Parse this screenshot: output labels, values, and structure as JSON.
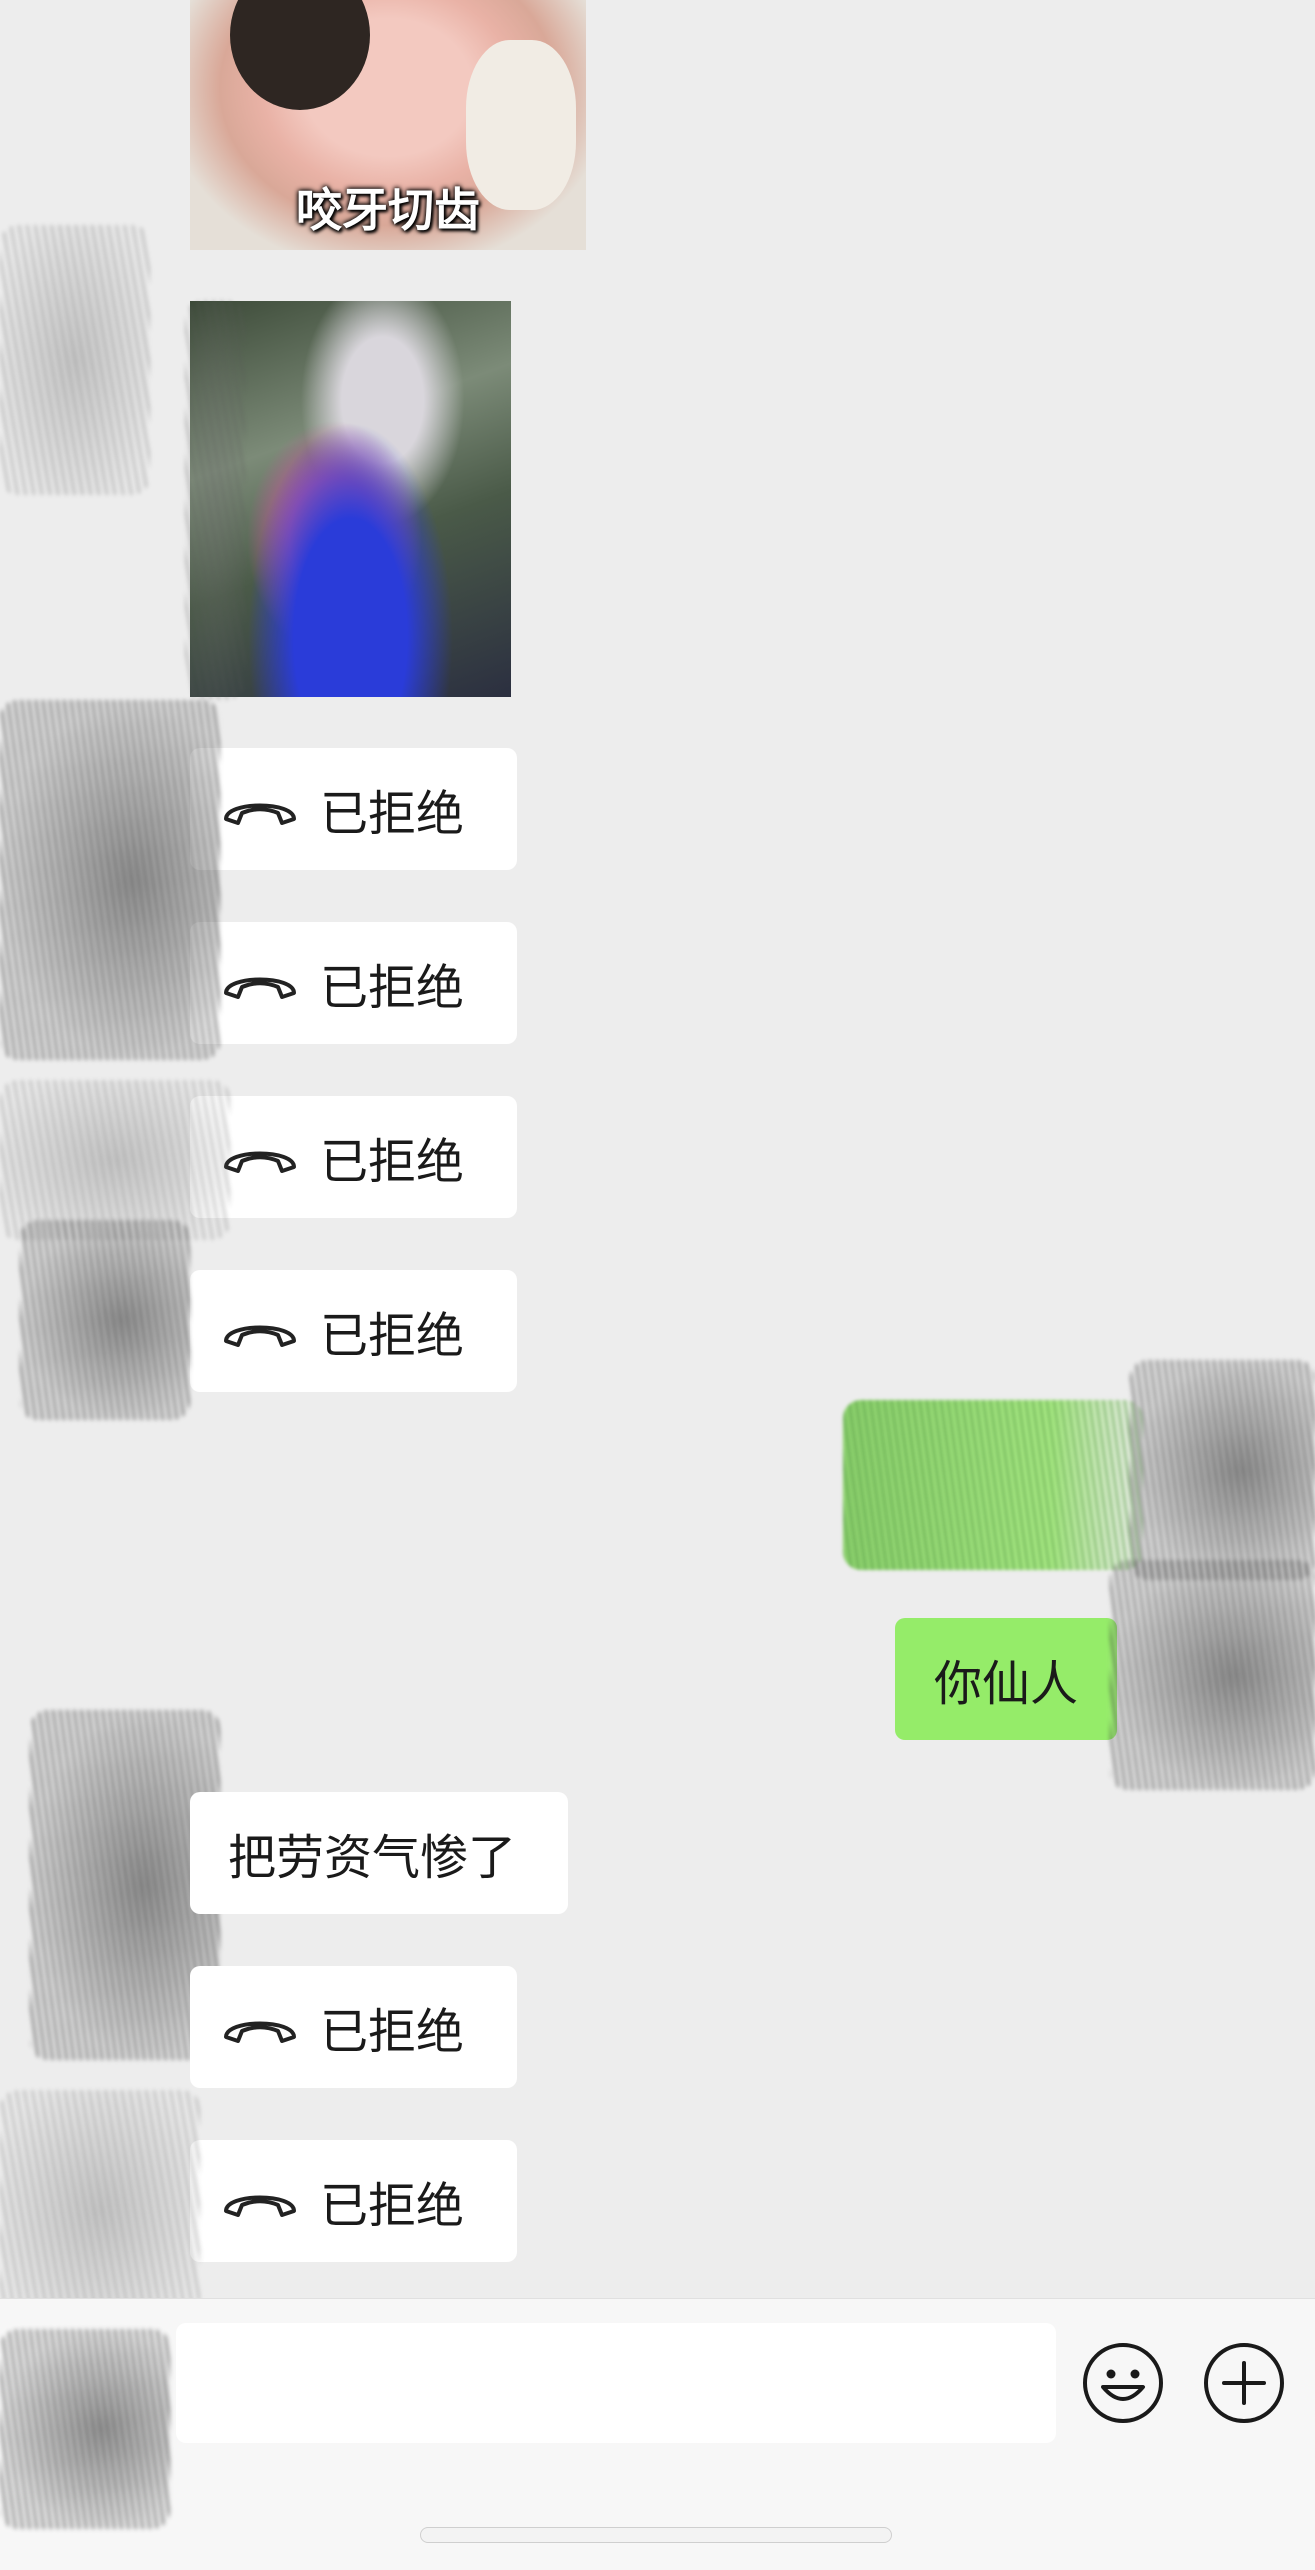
{
  "sticker": {
    "caption": "咬牙切齿"
  },
  "messages": {
    "call_1": {
      "icon": "phone-hangup-icon",
      "status": "已拒绝"
    },
    "call_2": {
      "icon": "phone-hangup-icon",
      "status": "已拒绝"
    },
    "call_3": {
      "icon": "phone-hangup-icon",
      "status": "已拒绝"
    },
    "call_4": {
      "icon": "phone-hangup-icon",
      "status": "已拒绝"
    },
    "outgoing_2": {
      "text": "你仙人"
    },
    "incoming_text": {
      "text": "把劳资气惨了"
    },
    "call_5": {
      "icon": "phone-hangup-icon",
      "status": "已拒绝"
    },
    "call_6": {
      "icon": "phone-hangup-icon",
      "status": "已拒绝"
    }
  },
  "input_bar": {
    "message_value": "",
    "emoji_icon": "smiley-icon",
    "more_icon": "plus-circle-icon"
  },
  "colors": {
    "background": "#ededed",
    "incoming_bubble": "#ffffff",
    "outgoing_bubble": "#95ec69",
    "input_bar": "#f7f7f7"
  }
}
